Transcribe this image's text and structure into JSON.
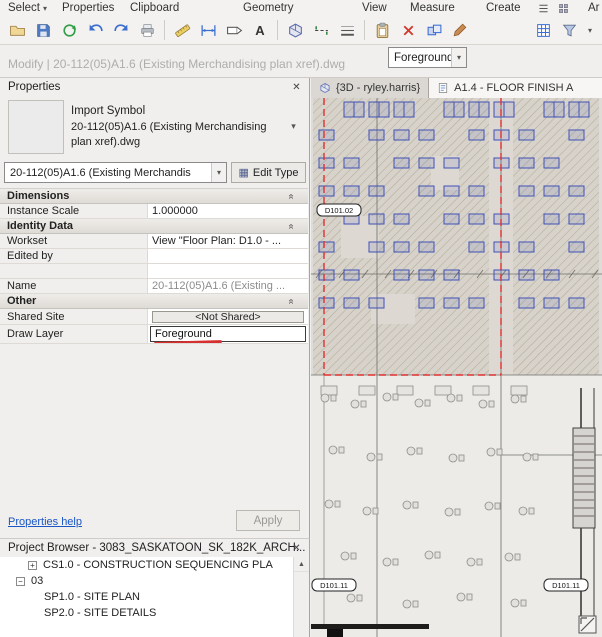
{
  "icons": {
    "caret_down": "▾",
    "close": "✕",
    "double_chevron": "«",
    "plus": "+",
    "minus": "−",
    "up_arrow": "▲",
    "edit_type_grid": "▦",
    "text_tool": "A"
  },
  "ribbon": {
    "tabs": [
      "Select",
      "Properties",
      "Clipboard",
      "Geometry",
      "View",
      "Measure",
      "Create",
      "Ar"
    ]
  },
  "options_bar": {
    "modify_label": "Modify | 20-112(05)A1.6 (Existing Merchandising plan xref).dwg",
    "draw_layer_value": "Foreground"
  },
  "properties": {
    "title": "Properties",
    "preview_kind": "Import Symbol",
    "preview_name_line1": "20-112(05)A1.6 (Existing Merchandising",
    "preview_name_line2": "plan xref).dwg",
    "type_selector_value": "20-112(05)A1.6 (Existing Merchandis",
    "edit_type_label": "Edit Type",
    "section_dimensions": "Dimensions",
    "row_instance_scale_label": "Instance Scale",
    "row_instance_scale_value": "1.000000",
    "section_identity": "Identity Data",
    "row_workset_label": "Workset",
    "row_workset_value": "View \"Floor Plan: D1.0 - ...",
    "row_edited_by_label": "Edited by",
    "row_edited_by_value": "",
    "row_name_label": "Name",
    "row_name_value": "20-112(05)A1.6 (Existing ...",
    "section_other": "Other",
    "row_shared_site_label": "Shared Site",
    "row_shared_site_value": "<Not Shared>",
    "row_draw_layer_label": "Draw Layer",
    "row_draw_layer_value": "Foreground",
    "help_link": "Properties help",
    "apply_label": "Apply"
  },
  "project_browser": {
    "title": "Project Browser - 3083_SASKATOON_SK_182K_ARCH...",
    "items": [
      "CS1.0 - CONSTRUCTION SEQUENCING PLA",
      "03",
      "SP1.0 - SITE PLAN",
      "SP2.0 - SITE DETAILS"
    ]
  },
  "drawing": {
    "tab_3d": "{3D - ryley.harris}",
    "tab_sheet": "A1.4 - FLOOR FINISH A",
    "tags": [
      "D101.02",
      "D101.11",
      "D101.11"
    ]
  },
  "colors": {
    "fixture_blue": "#3f51b5",
    "boundary_red": "#e03030",
    "annotation_red": "#d62f2f"
  }
}
